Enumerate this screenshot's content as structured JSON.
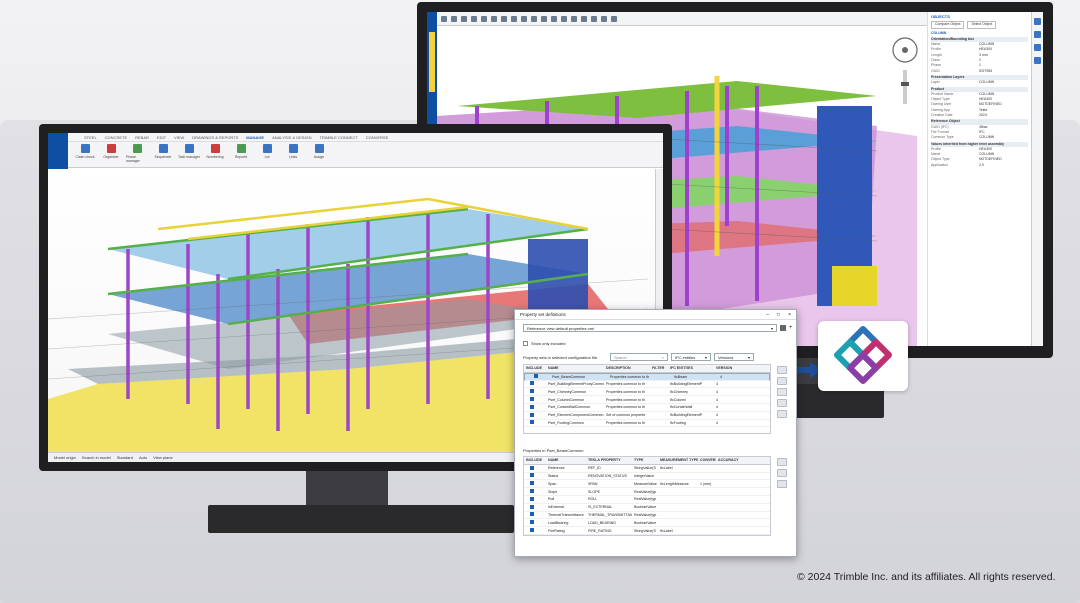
{
  "front": {
    "tabs": [
      "STEEL",
      "CONCRETE",
      "REBAR",
      "EDIT",
      "VIEW",
      "DRAWINGS & REPORTS",
      "MANAGE",
      "ANALYSIS & DESIGN",
      "TRIMBLE CONNECT",
      "CONVERSE"
    ],
    "active_tab": "MANAGE",
    "ribbon": [
      "Clash check",
      "Organizer",
      "Phase manager",
      "Sequencer",
      "Task manager",
      "Numbering",
      "Reports",
      "Lot",
      "Links",
      "Assign"
    ],
    "status_items": [
      "Model origin",
      "Search in model",
      "Standard",
      "Auto",
      "View plane"
    ]
  },
  "back": {
    "panel": {
      "title": "OBJECTS",
      "object": "COLUMN",
      "sections": [
        {
          "name": "Orientation/Bounding box",
          "rows": [
            [
              "Name",
              "COLUMN"
            ],
            [
              "Profile",
              "HEA300"
            ],
            [
              "Length",
              "3 mm"
            ],
            [
              "Class",
              "2"
            ],
            [
              "Phase",
              "1"
            ],
            [
              "GUID",
              "ID27983"
            ]
          ]
        },
        {
          "name": "Presentation Layers",
          "rows": [
            [
              "Layer",
              "COLUMN"
            ]
          ]
        },
        {
          "name": "Product",
          "rows": [
            [
              "Product Name",
              "COLUMN"
            ],
            [
              "Object Type",
              "HEA300"
            ],
            [
              "Owning User",
              "NOTDEFINED"
            ],
            [
              "Owning App",
              "Tekla"
            ],
            [
              "Creation Date",
              "2024"
            ]
          ]
        },
        {
          "name": "Reference Object",
          "rows": [
            [
              "GUID (IFC)",
              "4fbac"
            ],
            [
              "File Format",
              "IFC"
            ],
            [
              "Common Type",
              "COLUMN"
            ]
          ]
        },
        {
          "name": "Values inherited from higher level assembly",
          "rows": [
            [
              "Profile",
              "HEA300"
            ],
            [
              "Name",
              "COLUMN"
            ],
            [
              "Object Type",
              "NOTDEFINED"
            ],
            [
              "Application",
              "2.0"
            ]
          ]
        }
      ]
    }
  },
  "dialog": {
    "title": "Property set definitions",
    "config": "Reference view default properties.xml",
    "show_only_included": "Show only included",
    "section1": "Property sets in selected configuration file",
    "search_placeholder": "Search",
    "filter1": "IFC entities",
    "filter2": "Versions",
    "headers1": [
      "INCLUDE",
      "NAME",
      "DESCRIPTION",
      "FILTER",
      "IFC ENTITIES",
      "VERSION"
    ],
    "rows1": [
      [
        "Pset_BeamCommon",
        "Properties common to th",
        "",
        "IfcBeam",
        "4"
      ],
      [
        "Pset_BuildingElementProxyCommon",
        "Properties common to th",
        "",
        "IfcBuildingElementP",
        "4"
      ],
      [
        "Pset_ChimneyCommon",
        "Properties common to th",
        "",
        "IfcChimney",
        "4"
      ],
      [
        "Pset_ColumnCommon",
        "Properties common to th",
        "",
        "IfcColumn",
        "4"
      ],
      [
        "Pset_CurtainWallCommon",
        "Properties common to th",
        "",
        "IfcCurtainWall",
        "4"
      ],
      [
        "Pset_ElementComponentCommon",
        "Set of common propertie",
        "",
        "IfcBuildingElementP",
        "4"
      ],
      [
        "Pset_FootingCommon",
        "Properties common to th",
        "",
        "IfcFooting",
        "4"
      ]
    ],
    "section2": "Properties in Pset_BeamCommon",
    "headers2": [
      "INCLUDE",
      "NAME",
      "TEKLA PROPERTY",
      "TYPE",
      "MEASUREMENT TYPE",
      "CONVERS",
      "ACCURACY"
    ],
    "rows2": [
      [
        "Reference",
        "REF_ID",
        "StringValue(S",
        "IfcLabel",
        "",
        ""
      ],
      [
        "Status",
        "RENOVATION_STATUS",
        "IntegerValue",
        "",
        "",
        ""
      ],
      [
        "Span",
        "SPAN",
        "MeasureValue",
        "IfcLengthMeasure",
        "1 (mm)",
        ""
      ],
      [
        "Slope",
        "SLOPE",
        "RealValue(typ",
        "",
        "",
        ""
      ],
      [
        "Roll",
        "ROLL",
        "RealValue(typ",
        "",
        "",
        ""
      ],
      [
        "IsExternal",
        "IS_EXTERNAL",
        "BooleanValue",
        "",
        "",
        ""
      ],
      [
        "ThermalTransmittance",
        "THERMAL_TRANSMITTAN",
        "RealValue(typ",
        "",
        "",
        ""
      ],
      [
        "LoadBearing",
        "LOAD_BEARING",
        "BooleanValue",
        "",
        "",
        ""
      ],
      [
        "FireRating",
        "FIRE_RATING",
        "StringValue(S",
        "IfcLabel",
        "",
        ""
      ]
    ]
  },
  "copyright": "© 2024 Trimble Inc. and its affiliates. All rights reserved."
}
